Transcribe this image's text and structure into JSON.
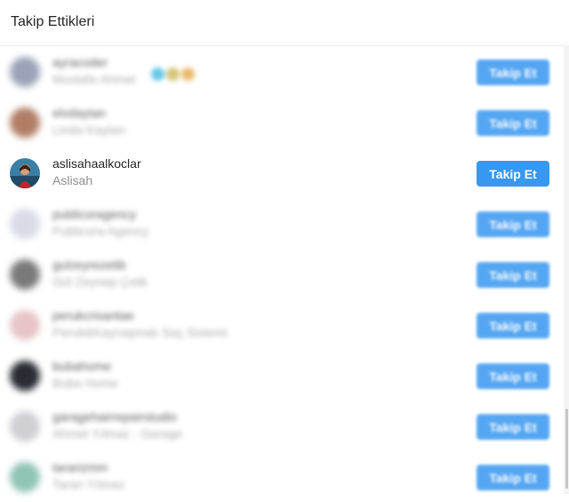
{
  "header": {
    "title": "Takip Ettikleri"
  },
  "users": [
    {
      "username": "ayracoder",
      "fullname": "Mustafa Ahmet",
      "button": "Takip Et",
      "avatar_color": "#9aa3b8",
      "emoji": [
        "heart-emoji",
        "face-emoji",
        "face-emoji"
      ]
    },
    {
      "username": "elvdaytan",
      "fullname": "Linda Kaytan",
      "button": "Takip Et",
      "avatar_color": "#b07e66"
    },
    {
      "username": "aslisahaalkoclar",
      "fullname": "Aslisah",
      "button": "Takip Et",
      "avatar_color": "#2f5d7a"
    },
    {
      "username": "publicoragency",
      "fullname": "Publicora Agency",
      "button": "Takip Et",
      "avatar_color": "#d9dbe6"
    },
    {
      "username": "gulzeyrezetib",
      "fullname": "Gül Zeynep Çelik",
      "button": "Takip Et",
      "avatar_color": "#7a7a7a"
    },
    {
      "username": "perukcrisantae",
      "fullname": "Peruk&Kaynaşmalı Saç Sistemi",
      "button": "Takip Et",
      "avatar_color": "#e7c4c8"
    },
    {
      "username": "bubahome",
      "fullname": "Buba Home",
      "button": "Takip Et",
      "avatar_color": "#2a2c33"
    },
    {
      "username": "garagehairrepairstudio",
      "fullname": "Ahmet Yılmaz - Garage",
      "button": "Takip Et",
      "avatar_color": "#cfcfd4"
    },
    {
      "username": "tararizmm",
      "fullname": "Taran Yılmaz",
      "button": "Takip Et",
      "avatar_color": "#8fc4b7"
    }
  ],
  "colors": {
    "button_bg": "#3897f0",
    "button_text": "#ffffff",
    "username": "#262626",
    "fullname": "#8e8e8e"
  }
}
